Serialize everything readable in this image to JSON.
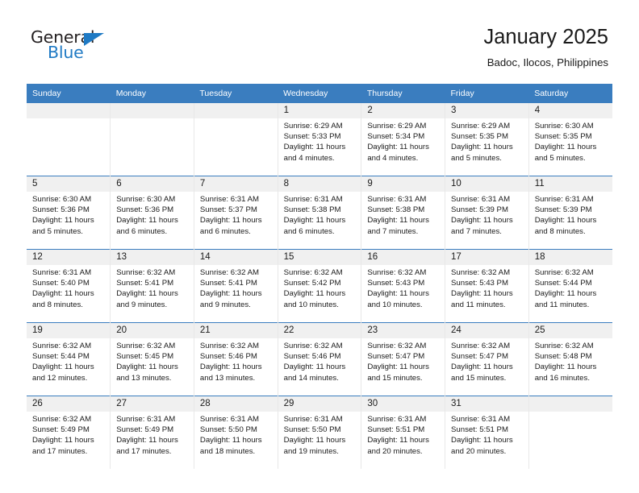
{
  "brand": {
    "name_part1": "General",
    "name_part2": "Blue",
    "accent_color": "#1f7ac4"
  },
  "header": {
    "title": "January 2025",
    "subtitle": "Badoc, Ilocos, Philippines"
  },
  "calendar": {
    "header_bg": "#3a7dbf",
    "daynum_bg": "#f0f0f0",
    "weekdays": [
      "Sunday",
      "Monday",
      "Tuesday",
      "Wednesday",
      "Thursday",
      "Friday",
      "Saturday"
    ],
    "weeks": [
      [
        {
          "day": "",
          "sunrise": "",
          "sunset": "",
          "daylight": ""
        },
        {
          "day": "",
          "sunrise": "",
          "sunset": "",
          "daylight": ""
        },
        {
          "day": "",
          "sunrise": "",
          "sunset": "",
          "daylight": ""
        },
        {
          "day": "1",
          "sunrise": "Sunrise: 6:29 AM",
          "sunset": "Sunset: 5:33 PM",
          "daylight": "Daylight: 11 hours and 4 minutes."
        },
        {
          "day": "2",
          "sunrise": "Sunrise: 6:29 AM",
          "sunset": "Sunset: 5:34 PM",
          "daylight": "Daylight: 11 hours and 4 minutes."
        },
        {
          "day": "3",
          "sunrise": "Sunrise: 6:29 AM",
          "sunset": "Sunset: 5:35 PM",
          "daylight": "Daylight: 11 hours and 5 minutes."
        },
        {
          "day": "4",
          "sunrise": "Sunrise: 6:30 AM",
          "sunset": "Sunset: 5:35 PM",
          "daylight": "Daylight: 11 hours and 5 minutes."
        }
      ],
      [
        {
          "day": "5",
          "sunrise": "Sunrise: 6:30 AM",
          "sunset": "Sunset: 5:36 PM",
          "daylight": "Daylight: 11 hours and 5 minutes."
        },
        {
          "day": "6",
          "sunrise": "Sunrise: 6:30 AM",
          "sunset": "Sunset: 5:36 PM",
          "daylight": "Daylight: 11 hours and 6 minutes."
        },
        {
          "day": "7",
          "sunrise": "Sunrise: 6:31 AM",
          "sunset": "Sunset: 5:37 PM",
          "daylight": "Daylight: 11 hours and 6 minutes."
        },
        {
          "day": "8",
          "sunrise": "Sunrise: 6:31 AM",
          "sunset": "Sunset: 5:38 PM",
          "daylight": "Daylight: 11 hours and 6 minutes."
        },
        {
          "day": "9",
          "sunrise": "Sunrise: 6:31 AM",
          "sunset": "Sunset: 5:38 PM",
          "daylight": "Daylight: 11 hours and 7 minutes."
        },
        {
          "day": "10",
          "sunrise": "Sunrise: 6:31 AM",
          "sunset": "Sunset: 5:39 PM",
          "daylight": "Daylight: 11 hours and 7 minutes."
        },
        {
          "day": "11",
          "sunrise": "Sunrise: 6:31 AM",
          "sunset": "Sunset: 5:39 PM",
          "daylight": "Daylight: 11 hours and 8 minutes."
        }
      ],
      [
        {
          "day": "12",
          "sunrise": "Sunrise: 6:31 AM",
          "sunset": "Sunset: 5:40 PM",
          "daylight": "Daylight: 11 hours and 8 minutes."
        },
        {
          "day": "13",
          "sunrise": "Sunrise: 6:32 AM",
          "sunset": "Sunset: 5:41 PM",
          "daylight": "Daylight: 11 hours and 9 minutes."
        },
        {
          "day": "14",
          "sunrise": "Sunrise: 6:32 AM",
          "sunset": "Sunset: 5:41 PM",
          "daylight": "Daylight: 11 hours and 9 minutes."
        },
        {
          "day": "15",
          "sunrise": "Sunrise: 6:32 AM",
          "sunset": "Sunset: 5:42 PM",
          "daylight": "Daylight: 11 hours and 10 minutes."
        },
        {
          "day": "16",
          "sunrise": "Sunrise: 6:32 AM",
          "sunset": "Sunset: 5:43 PM",
          "daylight": "Daylight: 11 hours and 10 minutes."
        },
        {
          "day": "17",
          "sunrise": "Sunrise: 6:32 AM",
          "sunset": "Sunset: 5:43 PM",
          "daylight": "Daylight: 11 hours and 11 minutes."
        },
        {
          "day": "18",
          "sunrise": "Sunrise: 6:32 AM",
          "sunset": "Sunset: 5:44 PM",
          "daylight": "Daylight: 11 hours and 11 minutes."
        }
      ],
      [
        {
          "day": "19",
          "sunrise": "Sunrise: 6:32 AM",
          "sunset": "Sunset: 5:44 PM",
          "daylight": "Daylight: 11 hours and 12 minutes."
        },
        {
          "day": "20",
          "sunrise": "Sunrise: 6:32 AM",
          "sunset": "Sunset: 5:45 PM",
          "daylight": "Daylight: 11 hours and 13 minutes."
        },
        {
          "day": "21",
          "sunrise": "Sunrise: 6:32 AM",
          "sunset": "Sunset: 5:46 PM",
          "daylight": "Daylight: 11 hours and 13 minutes."
        },
        {
          "day": "22",
          "sunrise": "Sunrise: 6:32 AM",
          "sunset": "Sunset: 5:46 PM",
          "daylight": "Daylight: 11 hours and 14 minutes."
        },
        {
          "day": "23",
          "sunrise": "Sunrise: 6:32 AM",
          "sunset": "Sunset: 5:47 PM",
          "daylight": "Daylight: 11 hours and 15 minutes."
        },
        {
          "day": "24",
          "sunrise": "Sunrise: 6:32 AM",
          "sunset": "Sunset: 5:47 PM",
          "daylight": "Daylight: 11 hours and 15 minutes."
        },
        {
          "day": "25",
          "sunrise": "Sunrise: 6:32 AM",
          "sunset": "Sunset: 5:48 PM",
          "daylight": "Daylight: 11 hours and 16 minutes."
        }
      ],
      [
        {
          "day": "26",
          "sunrise": "Sunrise: 6:32 AM",
          "sunset": "Sunset: 5:49 PM",
          "daylight": "Daylight: 11 hours and 17 minutes."
        },
        {
          "day": "27",
          "sunrise": "Sunrise: 6:31 AM",
          "sunset": "Sunset: 5:49 PM",
          "daylight": "Daylight: 11 hours and 17 minutes."
        },
        {
          "day": "28",
          "sunrise": "Sunrise: 6:31 AM",
          "sunset": "Sunset: 5:50 PM",
          "daylight": "Daylight: 11 hours and 18 minutes."
        },
        {
          "day": "29",
          "sunrise": "Sunrise: 6:31 AM",
          "sunset": "Sunset: 5:50 PM",
          "daylight": "Daylight: 11 hours and 19 minutes."
        },
        {
          "day": "30",
          "sunrise": "Sunrise: 6:31 AM",
          "sunset": "Sunset: 5:51 PM",
          "daylight": "Daylight: 11 hours and 20 minutes."
        },
        {
          "day": "31",
          "sunrise": "Sunrise: 6:31 AM",
          "sunset": "Sunset: 5:51 PM",
          "daylight": "Daylight: 11 hours and 20 minutes."
        },
        {
          "day": "",
          "sunrise": "",
          "sunset": "",
          "daylight": ""
        }
      ]
    ]
  }
}
